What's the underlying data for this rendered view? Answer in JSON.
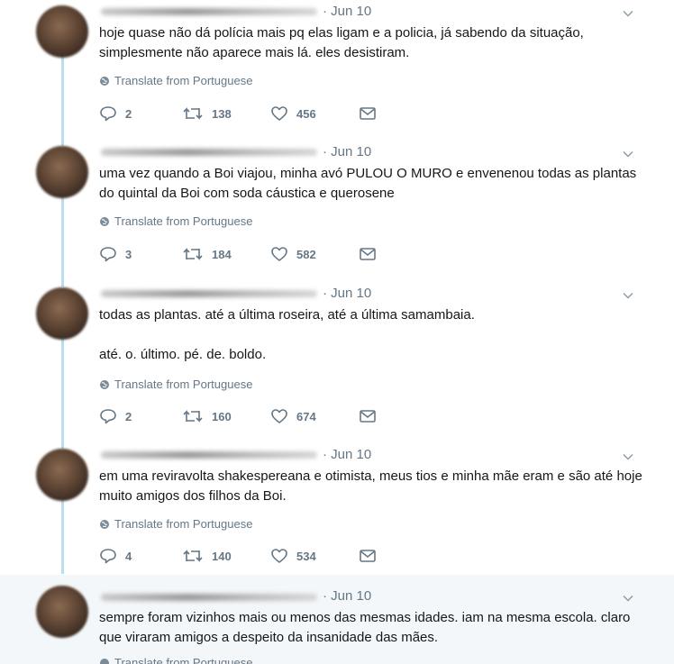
{
  "tweets": [
    {
      "date": "· Jun 10",
      "text": "hoje quase não dá polícia mais pq elas ligam e a policia, já sabendo da situação, simplesmente não aparece mais lá. eles desistiram.",
      "translate": "Translate from Portuguese",
      "replies": "2",
      "retweets": "138",
      "likes": "456"
    },
    {
      "date": "· Jun 10",
      "text": "uma vez quando a Boi viajou, minha avó PULOU O MURO e envenenou todas as plantas do quintal da Boi com soda cáustica e querosene",
      "translate": "Translate from Portuguese",
      "replies": "3",
      "retweets": "184",
      "likes": "582"
    },
    {
      "date": "· Jun 10",
      "text": "todas as plantas. até a última roseira, até a última samambaia.",
      "text2": "até. o. último. pé. de. boldo.",
      "translate": "Translate from Portuguese",
      "replies": "2",
      "retweets": "160",
      "likes": "674"
    },
    {
      "date": "· Jun 10",
      "text": "em uma reviravolta shakespereana e otimista, meus tios e minha mãe eram e são até hoje muito amigos dos filhos da Boi.",
      "translate": "Translate from Portuguese",
      "replies": "4",
      "retweets": "140",
      "likes": "534"
    },
    {
      "date": "· Jun 10",
      "text": "sempre foram vizinhos mais ou menos das mesmas idades. iam na mesma escola. claro que viraram amigos a despeito da insanidade das mães.",
      "translate": "Translate from Portuguese"
    }
  ]
}
